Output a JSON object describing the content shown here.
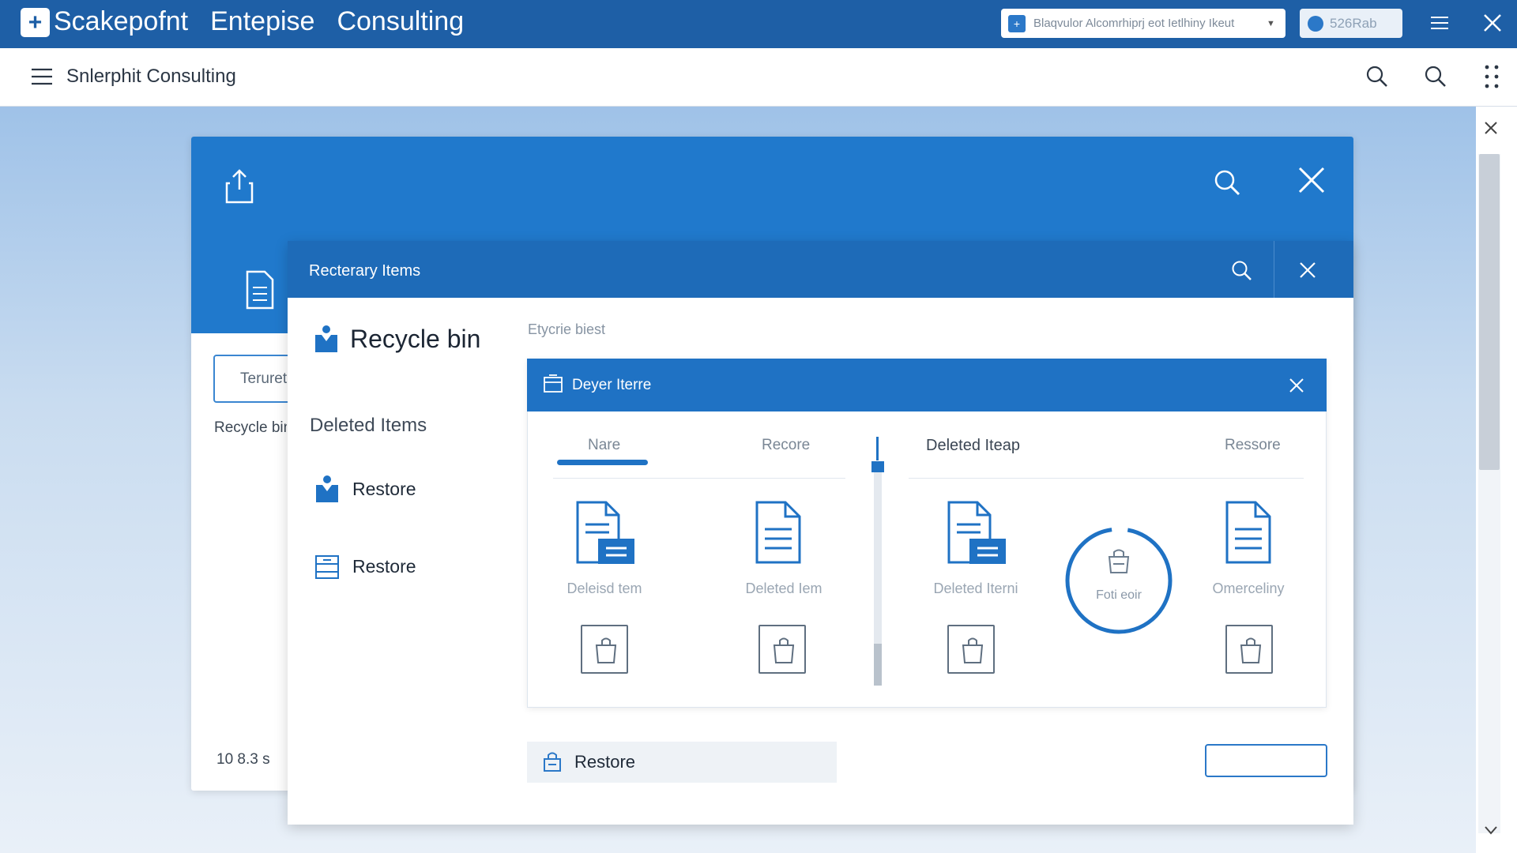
{
  "topbar": {
    "brand_logo_glyph": "+",
    "brand_words": [
      "Scakepofnt",
      "Entepise",
      "Consulting"
    ],
    "dropdown_text": "Blaqvulor Alcomrhiprj eot   Ietlhiny Ikeut",
    "user_text": "526Rab",
    "icons": [
      "plus-logo-icon",
      "dropdown-caret-icon",
      "menu-icon",
      "close-icon"
    ]
  },
  "subbar": {
    "site_title": "Snlerphit Consulting",
    "icons": [
      "hamburger-icon",
      "search-icon",
      "search-icon",
      "grid-icon"
    ]
  },
  "back_panel": {
    "input_value": "Teruret",
    "label": "Recycle bin",
    "count": "10 8.3 s"
  },
  "dialog": {
    "title": "Recterary Items",
    "nav_heading": "Recycle bin",
    "nav_section": "Deleted Items",
    "nav_items": [
      {
        "label": "Restore",
        "icon": "recycle-user-icon"
      },
      {
        "label": "Restore",
        "icon": "archive-icon"
      }
    ],
    "section_label": "Etycrie biest"
  },
  "inner_card": {
    "title": "Deyer Iterre",
    "columns": [
      "Nare",
      "Recore",
      "Deleted Iteap",
      "Ressore"
    ],
    "items": [
      {
        "label": "Deleisd tem"
      },
      {
        "label": "Deleted Iem"
      },
      {
        "label": "Deleted Iterni"
      },
      {
        "label": "Omerceliny"
      }
    ],
    "ring_label": "Foti eoir",
    "ring_progress": 0.95
  },
  "footer": {
    "restore_label": "Restore",
    "outline_button_label": ""
  },
  "colors": {
    "topbar": "#1e5fa6",
    "accent": "#1f72c4",
    "panel_header": "#2079cc"
  }
}
